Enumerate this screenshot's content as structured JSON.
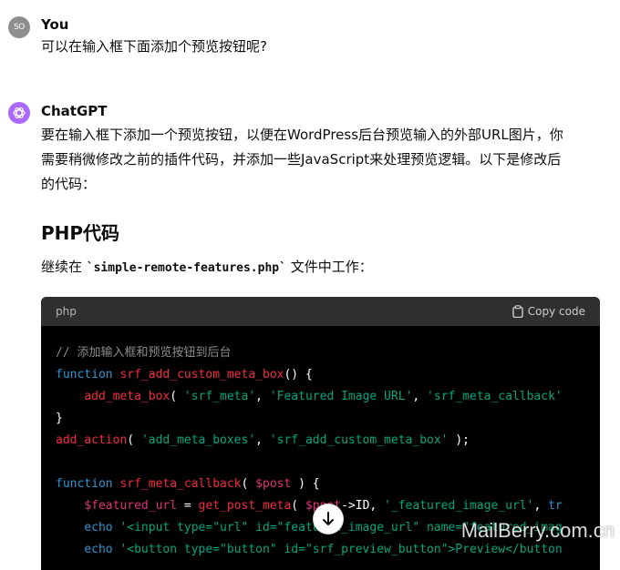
{
  "user": {
    "avatar_initials": "SO",
    "name": "You",
    "message": "可以在输入框下面添加个预览按钮呢?"
  },
  "assistant": {
    "name": "ChatGPT",
    "intro_lines": [
      "要在输入框下添加一个预览按钮，以便在WordPress后台预览输入的外部URL图片，你",
      "需要稍微修改之前的插件代码，并添加一些JavaScript来处理预览逻辑。以下是修改后",
      "的代码："
    ],
    "heading": "PHP代码",
    "file_note_prefix": "继续在 ",
    "file_name": "`simple-remote-features.php`",
    "file_note_suffix": " 文件中工作："
  },
  "code_block": {
    "language": "php",
    "copy_label": "Copy code"
  },
  "watermark": "MailBerry.com.cn",
  "colors": {
    "assistant_avatar": "#ab68ff",
    "code_bg": "#000000",
    "code_header_bg": "#2f2f2f"
  }
}
